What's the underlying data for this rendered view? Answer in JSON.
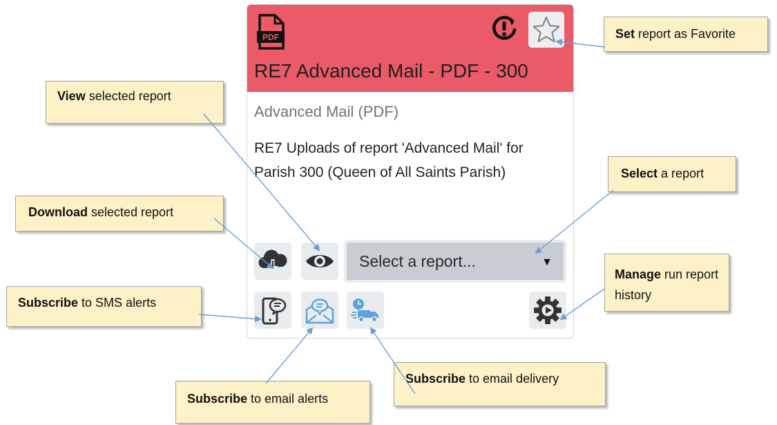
{
  "card": {
    "title": "RE7 Advanced Mail - PDF - 300",
    "subtitle": "Advanced Mail (PDF)",
    "description": "RE7 Uploads of report 'Advanced Mail' for Parish 300 (Queen of All Saints Parish)",
    "pdf_icon_label": "PDF",
    "select_placeholder": "Select a report...",
    "header_color": "#ea5a67"
  },
  "icons": {
    "file_type": "pdf-file-icon",
    "alert": "alert-history-icon",
    "favorite": "star-icon",
    "download": "cloud-download-icon",
    "view": "eye-icon",
    "sms": "phone-message-icon",
    "email_alerts": "envelope-message-icon",
    "email_delivery": "delivery-truck-icon",
    "manage": "gear-play-icon"
  },
  "callouts": {
    "favorite": {
      "bold": "Set",
      "text": " report as Favorite"
    },
    "view": {
      "bold": "View",
      "text": " selected report"
    },
    "download": {
      "bold": "Download",
      "text": " selected report"
    },
    "select": {
      "bold": "Select",
      "text": " a report"
    },
    "manage": {
      "bold": "Manage",
      "text": " run report history"
    },
    "sms": {
      "bold": "Subscribe",
      "text": " to SMS alerts"
    },
    "email_delivery": {
      "bold": "Subscribe",
      "text": " to email delivery"
    },
    "email_alerts": {
      "bold": "Subscribe",
      "text": " to email alerts"
    }
  },
  "colors": {
    "callout_bg": "#fdf1c7",
    "arrow": "#6a9fd6",
    "icon_blue": "#5fa0dc",
    "icon_dark": "#333333"
  }
}
